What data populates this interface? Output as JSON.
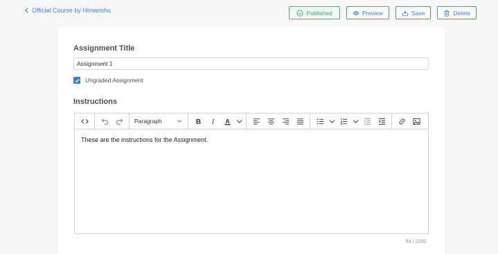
{
  "nav": {
    "back_label": "Official Course by Himanshu"
  },
  "actions": {
    "published_label": "Published",
    "preview_label": "Preview",
    "save_label": "Save",
    "delete_label": "Delete"
  },
  "form": {
    "title_label": "Assignment Title",
    "title_value": "Assignment 1",
    "ungraded_label": "Ungraded Assignment",
    "ungraded_checked": true,
    "instructions_label": "Instructions"
  },
  "editor": {
    "block_format": "Paragraph",
    "content": "These are the instructions for the Assignment.",
    "char_count": "53 / 2000"
  },
  "colors": {
    "accent": "#3b7dd0",
    "published": "#3fa56c"
  }
}
